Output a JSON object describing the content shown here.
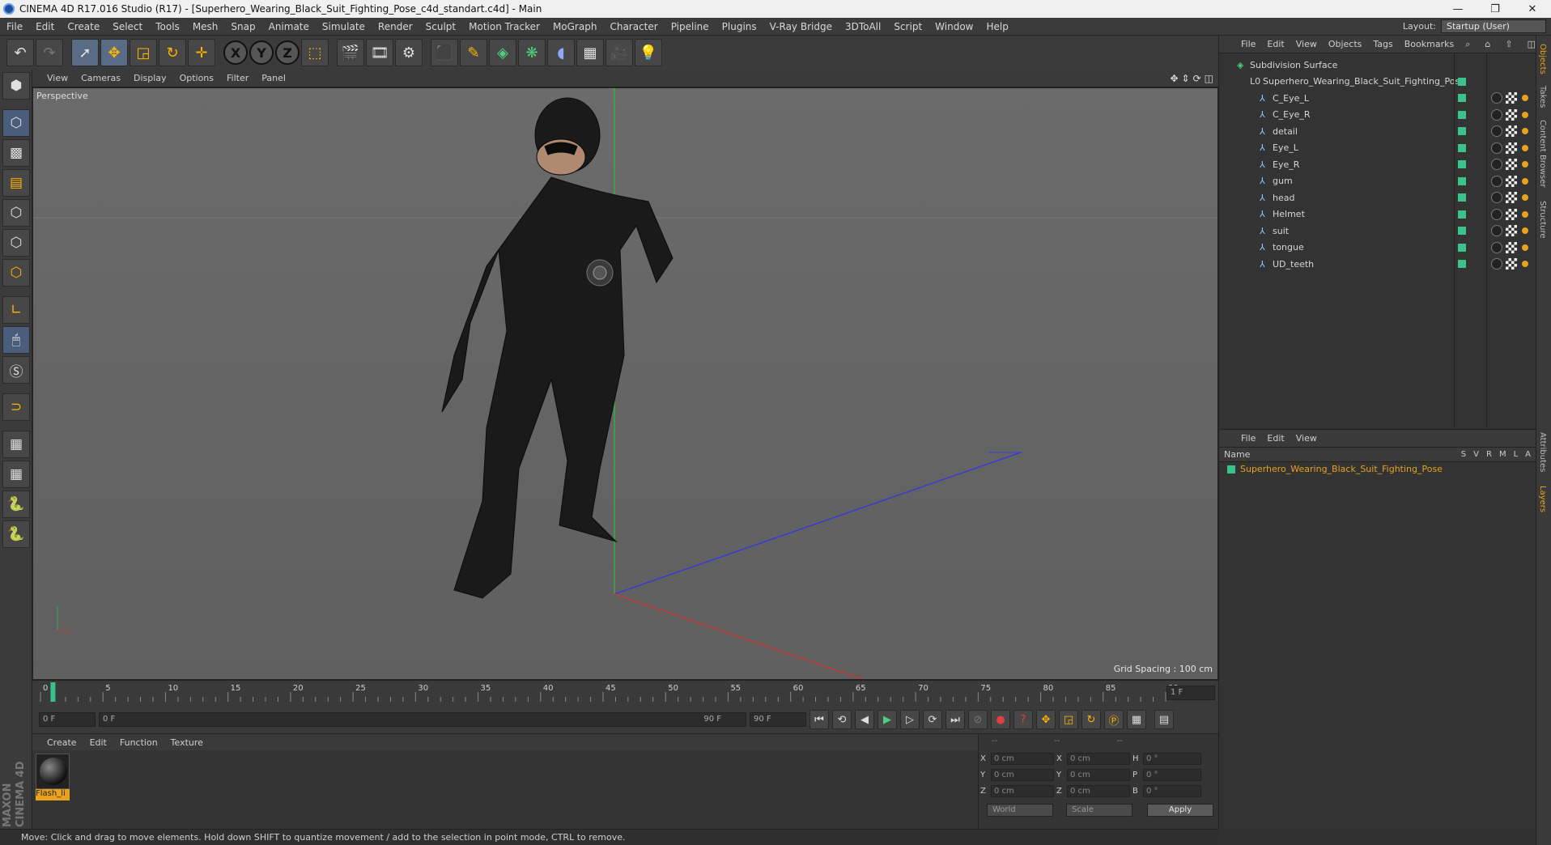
{
  "window": {
    "title": "CINEMA 4D R17.016 Studio (R17) - [Superhero_Wearing_Black_Suit_Fighting_Pose_c4d_standart.c4d] - Main",
    "minimize": "—",
    "maximize": "❐",
    "close": "✕"
  },
  "menubar": {
    "items": [
      "File",
      "Edit",
      "Create",
      "Select",
      "Tools",
      "Mesh",
      "Snap",
      "Animate",
      "Simulate",
      "Render",
      "Sculpt",
      "Motion Tracker",
      "MoGraph",
      "Character",
      "Pipeline",
      "Plugins",
      "V-Ray Bridge",
      "3DToAll",
      "Script",
      "Window",
      "Help"
    ],
    "layout_label": "Layout:",
    "layout_value": "Startup (User)"
  },
  "viewport": {
    "menu": [
      "View",
      "Cameras",
      "Display",
      "Options",
      "Filter",
      "Panel"
    ],
    "label": "Perspective",
    "grid_spacing": "Grid Spacing : 100 cm"
  },
  "timeline": {
    "ticks": [
      "0",
      "5",
      "10",
      "15",
      "20",
      "25",
      "30",
      "35",
      "40",
      "45",
      "50",
      "55",
      "60",
      "65",
      "70",
      "75",
      "80",
      "85",
      "90"
    ],
    "current_frame_display": "1 F"
  },
  "anim": {
    "start_field": "0 F",
    "range_start": "0 F",
    "range_end": "90 F",
    "end_field": "90 F"
  },
  "material_manager": {
    "menu": [
      "Create",
      "Edit",
      "Function",
      "Texture"
    ],
    "material_label": "Flash_li"
  },
  "coordinates": {
    "header": [
      "--",
      "--",
      "--"
    ],
    "rows": [
      {
        "l1": "X",
        "v1": "0 cm",
        "l2": "X",
        "v2": "0 cm",
        "l3": "H",
        "v3": "0 °"
      },
      {
        "l1": "Y",
        "v1": "0 cm",
        "l2": "Y",
        "v2": "0 cm",
        "l3": "P",
        "v3": "0 °"
      },
      {
        "l1": "Z",
        "v1": "0 cm",
        "l2": "Z",
        "v2": "0 cm",
        "l3": "B",
        "v3": "0 °"
      }
    ],
    "world_select": "World",
    "scale_select": "Scale",
    "apply_label": "Apply"
  },
  "status": {
    "text": "Move: Click and drag to move elements. Hold down SHIFT to quantize movement / add to the selection in point mode, CTRL to remove."
  },
  "object_manager": {
    "menu": [
      "File",
      "Edit",
      "View",
      "Objects",
      "Tags",
      "Bookmarks"
    ],
    "root": "Subdivision Surface",
    "group": "Superhero_Wearing_Black_Suit_Fighting_Pose",
    "children": [
      "C_Eye_L",
      "C_Eye_R",
      "detail",
      "Eye_L",
      "Eye_R",
      "gum",
      "head",
      "Helmet",
      "suit",
      "tongue",
      "UD_teeth"
    ]
  },
  "layer_manager": {
    "menu": [
      "File",
      "Edit",
      "View"
    ],
    "name_header": "Name",
    "col_headers": [
      "S",
      "V",
      "R",
      "M",
      "L",
      "A"
    ],
    "layer_name": "Superhero_Wearing_Black_Suit_Fighting_Pose"
  },
  "side_tabs": [
    "Objects",
    "Takes",
    "Content Browser",
    "Structure",
    "Attributes",
    "Layers"
  ],
  "branding": {
    "maxon": "MAXON",
    "c4d": "CINEMA 4D"
  }
}
